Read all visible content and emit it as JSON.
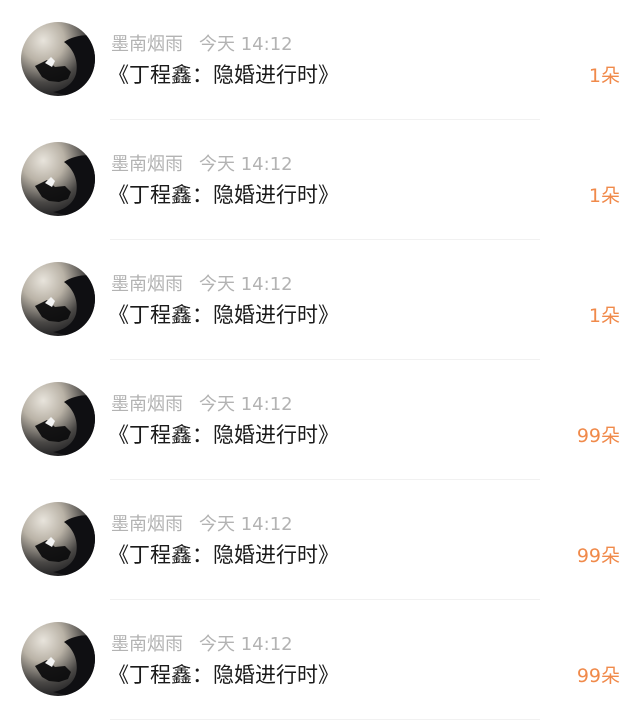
{
  "feed": {
    "items": [
      {
        "author": "墨南烟雨",
        "time": "今天 14:12",
        "title": "《丁程鑫：隐婚进行时》",
        "gift": "1朵"
      },
      {
        "author": "墨南烟雨",
        "time": "今天 14:12",
        "title": "《丁程鑫：隐婚进行时》",
        "gift": "1朵"
      },
      {
        "author": "墨南烟雨",
        "time": "今天 14:12",
        "title": "《丁程鑫：隐婚进行时》",
        "gift": "1朵"
      },
      {
        "author": "墨南烟雨",
        "time": "今天 14:12",
        "title": "《丁程鑫：隐婚进行时》",
        "gift": "99朵"
      },
      {
        "author": "墨南烟雨",
        "time": "今天 14:12",
        "title": "《丁程鑫：隐婚进行时》",
        "gift": "99朵"
      },
      {
        "author": "墨南烟雨",
        "time": "今天 14:12",
        "title": "《丁程鑫：隐婚进行时》",
        "gift": "99朵"
      }
    ]
  }
}
